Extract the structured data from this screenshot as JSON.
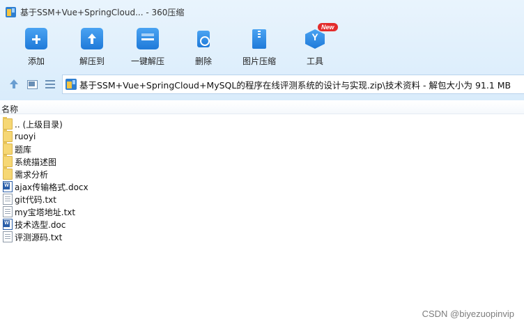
{
  "window": {
    "title": "基于SSM+Vue+SpringCloud... - 360压缩"
  },
  "toolbar": {
    "items": [
      {
        "label": "添加",
        "icon": "add-icon"
      },
      {
        "label": "解压到",
        "icon": "extract-to-icon"
      },
      {
        "label": "一键解压",
        "icon": "one-click-extract-icon"
      },
      {
        "label": "删除",
        "icon": "delete-icon"
      },
      {
        "label": "图片压缩",
        "icon": "image-compress-icon"
      },
      {
        "label": "工具",
        "icon": "tools-icon"
      }
    ],
    "new_badge": "New"
  },
  "address": {
    "path": "基于SSM+Vue+SpringCloud+MySQL的程序在线评测系统的设计与实现.zip\\技术资料 - 解包大小为 91.1 MB"
  },
  "list": {
    "column_name": "名称",
    "files": [
      {
        "name": ".. (上级目录)",
        "type": "folder"
      },
      {
        "name": "ruoyi",
        "type": "folder"
      },
      {
        "name": "题库",
        "type": "folder"
      },
      {
        "name": "系统描述图",
        "type": "folder"
      },
      {
        "name": "需求分析",
        "type": "folder"
      },
      {
        "name": "ajax传输格式.docx",
        "type": "doc"
      },
      {
        "name": "git代码.txt",
        "type": "txt"
      },
      {
        "name": "my宝塔地址.txt",
        "type": "txt"
      },
      {
        "name": "技术选型.doc",
        "type": "doc"
      },
      {
        "name": "评测源码.txt",
        "type": "txt"
      }
    ]
  },
  "watermark": "CSDN @biyezuopinvip"
}
